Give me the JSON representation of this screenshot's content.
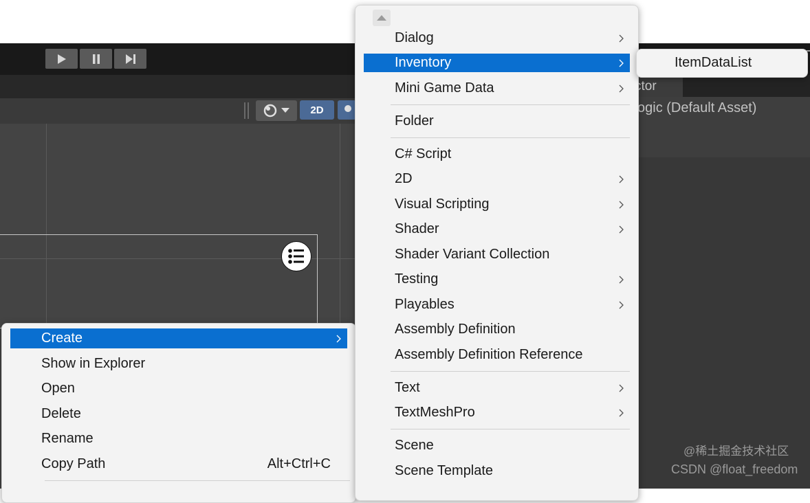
{
  "editor": {
    "scene_toolbar": {
      "mode_2d_label": "2D"
    }
  },
  "inspector": {
    "tab_label": "ctor",
    "title": "ogic (Default Asset)"
  },
  "context_menu": {
    "items": [
      {
        "label": "Create",
        "highlighted": true,
        "submenu": true
      },
      {
        "label": "Show in Explorer"
      },
      {
        "label": "Open"
      },
      {
        "label": "Delete"
      },
      {
        "label": "Rename"
      },
      {
        "label": "Copy Path",
        "shortcut": "Alt+Ctrl+C"
      }
    ]
  },
  "create_menu": {
    "items": [
      {
        "label": "Dialog",
        "submenu": true
      },
      {
        "label": "Inventory",
        "submenu": true,
        "highlighted": true
      },
      {
        "label": "Mini Game Data",
        "submenu": true
      },
      {
        "label": "Folder"
      },
      {
        "label": "C# Script"
      },
      {
        "label": "2D",
        "submenu": true
      },
      {
        "label": "Visual Scripting",
        "submenu": true
      },
      {
        "label": "Shader",
        "submenu": true
      },
      {
        "label": "Shader Variant Collection"
      },
      {
        "label": "Testing",
        "submenu": true
      },
      {
        "label": "Playables",
        "submenu": true
      },
      {
        "label": "Assembly Definition"
      },
      {
        "label": "Assembly Definition Reference"
      },
      {
        "label": "Text",
        "submenu": true
      },
      {
        "label": "TextMeshPro",
        "submenu": true
      },
      {
        "label": "Scene"
      },
      {
        "label": "Scene Template"
      }
    ]
  },
  "inventory_submenu": {
    "items": [
      {
        "label": "ItemDataList"
      }
    ]
  },
  "watermark": "CSDN @float_freedom",
  "watermark_cn": "@稀土掘金技术社区",
  "colors": {
    "highlight": "#0a6fd0",
    "menu_bg": "#f3f3f3",
    "editor_bg": "#3c3c3c",
    "toolbar_bg": "#191919",
    "mode_2d_bg": "#4b6a96"
  }
}
